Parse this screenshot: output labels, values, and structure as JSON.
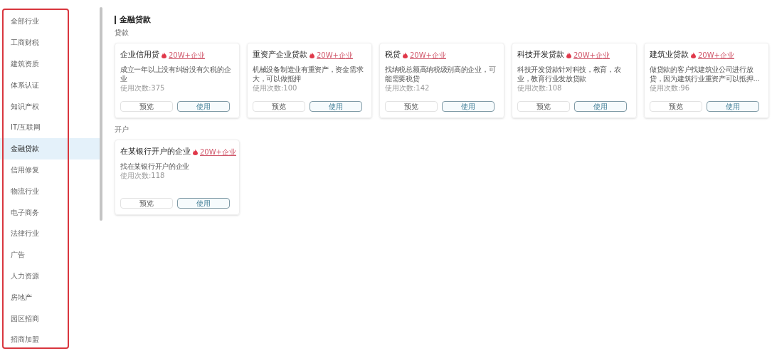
{
  "sidebar": {
    "items": [
      {
        "label": "全部行业",
        "selected": false
      },
      {
        "label": "工商财税",
        "selected": false
      },
      {
        "label": "建筑资质",
        "selected": false
      },
      {
        "label": "体系认证",
        "selected": false
      },
      {
        "label": "知识产权",
        "selected": false
      },
      {
        "label": "IT/互联网",
        "selected": false
      },
      {
        "label": "金融贷款",
        "selected": true
      },
      {
        "label": "信用修复",
        "selected": false
      },
      {
        "label": "物流行业",
        "selected": false
      },
      {
        "label": "电子商务",
        "selected": false
      },
      {
        "label": "法律行业",
        "selected": false
      },
      {
        "label": "广告",
        "selected": false
      },
      {
        "label": "人力资源",
        "selected": false
      },
      {
        "label": "房地产",
        "selected": false
      },
      {
        "label": "园区招商",
        "selected": false
      },
      {
        "label": "招商加盟",
        "selected": false
      }
    ]
  },
  "page_title": "金融贷款",
  "sections": [
    {
      "title": "贷款",
      "cards": [
        {
          "title": "企业信用贷",
          "tag": "20W+企业",
          "description": "成立一年以上没有纠纷没有欠税的企业",
          "usage": "使用次数:375",
          "buttons": [
            "预览",
            "使用"
          ]
        },
        {
          "title": "重资产企业贷款",
          "tag": "20W+企业",
          "description": "机械设备制造业有重资产，资金需求大，可以做抵押",
          "usage": "使用次数:100",
          "buttons": [
            "预览",
            "使用"
          ]
        },
        {
          "title": "税贷",
          "tag": "20W+企业",
          "description": "找纳税总额高纳税级别高的企业，可能需要税贷",
          "usage": "使用次数:142",
          "buttons": [
            "预览",
            "使用"
          ]
        },
        {
          "title": "科技开发贷款",
          "tag": "20W+企业",
          "description": "科技开发贷款针对科技，教育，农业，教育行业发放贷款",
          "usage": "使用次数:108",
          "buttons": [
            "预览",
            "使用"
          ]
        },
        {
          "title": "建筑业贷款",
          "tag": "20W+企业",
          "description": "做贷款的客户找建筑业公司进行放贷，因为建筑行业重资产可以抵押...",
          "usage": "使用次数:96",
          "buttons": [
            "预览",
            "使用"
          ]
        }
      ]
    },
    {
      "title": "开户",
      "cards": [
        {
          "title": "在某银行开户的企业",
          "tag": "20W+企业",
          "description": "找在某银行开户的企业",
          "usage": "使用次数:118",
          "buttons": [
            "预览",
            "使用"
          ]
        }
      ]
    }
  ]
}
